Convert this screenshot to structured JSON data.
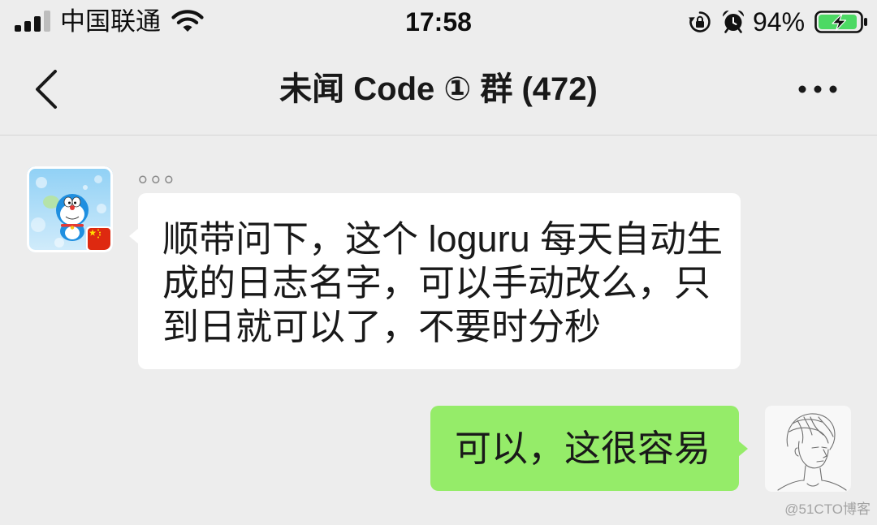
{
  "status_bar": {
    "carrier": "中国联通",
    "time": "17:58",
    "battery_percent": "94%",
    "battery_charging": true,
    "signal": {
      "active_bars": 3,
      "total_bars": 4
    },
    "icons": {
      "signal": "signal-icon",
      "wifi": "wifi-icon",
      "rotation_lock": "rotation-lock-icon",
      "alarm": "alarm-icon",
      "battery": "battery-charging-icon"
    }
  },
  "nav": {
    "title": "未闻 Code ① 群 (472)",
    "icons": {
      "back": "chevron-left-icon",
      "more": "more-icon"
    }
  },
  "chat": {
    "received_message": {
      "sender_name": "。。。",
      "lines": [
        "顺带问下，这个 loguru 每天自动生",
        "成的日志名字，可以手动改么，只",
        "到日就可以了，不要时分秒"
      ]
    },
    "sent_message": {
      "lines": [
        "可以，这很容易"
      ]
    }
  },
  "watermark": "@51CTO博客",
  "colors": {
    "background": "#ededed",
    "separator": "#d6d6d6",
    "incoming_bubble": "#ffffff",
    "outgoing_bubble": "#95ec69",
    "message_text": "#191919",
    "sender_name": "#8c8c8c",
    "battery_fill": "#4cd964",
    "signal_active": "#111111",
    "signal_inactive": "#bdbdbd"
  }
}
